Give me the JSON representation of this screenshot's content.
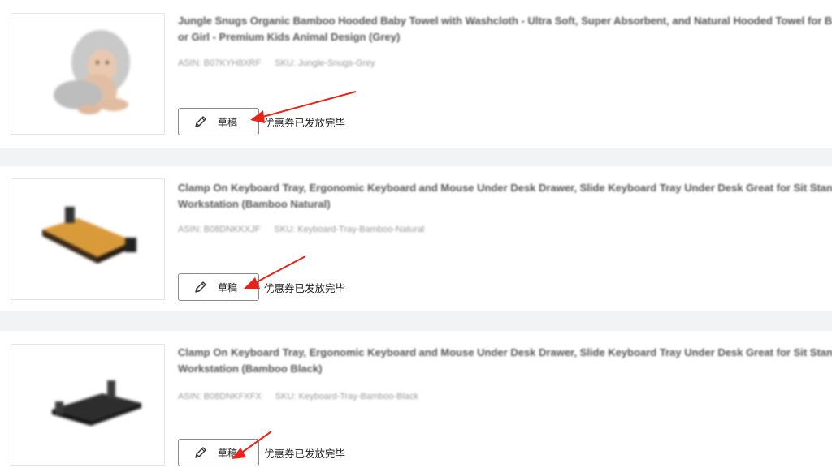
{
  "colors": {
    "arrow": "#e8231a",
    "separator": "#f2f3f5",
    "button_border": "#8a8a8a"
  },
  "products": [
    {
      "title": "Jungle Snugs Organic Bamboo Hooded Baby Towel with Washcloth - Ultra Soft, Super Absorbent, and Natural Hooded Towel for Baby Boy or Girl - Premium Kids Animal Design (Grey)",
      "asin": "ASIN: B07KYH8XRF",
      "sku": "SKU: Jungle-Snugs-Grey",
      "draft_label": "草稿",
      "coupon_status": "优惠券已发放完毕",
      "image_icon": "baby-towel-image"
    },
    {
      "title": "Clamp On Keyboard Tray, Ergonomic Keyboard and Mouse Under Desk Drawer, Slide Keyboard Tray Under Desk Great for Sit Stand Workstation (Bamboo Natural)",
      "asin": "ASIN: B08DNKKXJF",
      "sku": "SKU: Keyboard-Tray-Bamboo-Natural",
      "draft_label": "草稿",
      "coupon_status": "优惠券已发放完毕",
      "image_icon": "keyboard-tray-natural-image"
    },
    {
      "title": "Clamp On Keyboard Tray, Ergonomic Keyboard and Mouse Under Desk Drawer, Slide Keyboard Tray Under Desk Great for Sit Stand Workstation (Bamboo Black)",
      "asin": "ASIN: B08DNKFXFX",
      "sku": "SKU: Keyboard-Tray-Bamboo-Black",
      "draft_label": "草稿",
      "coupon_status": "优惠券已发放完毕",
      "image_icon": "keyboard-tray-black-image"
    }
  ]
}
